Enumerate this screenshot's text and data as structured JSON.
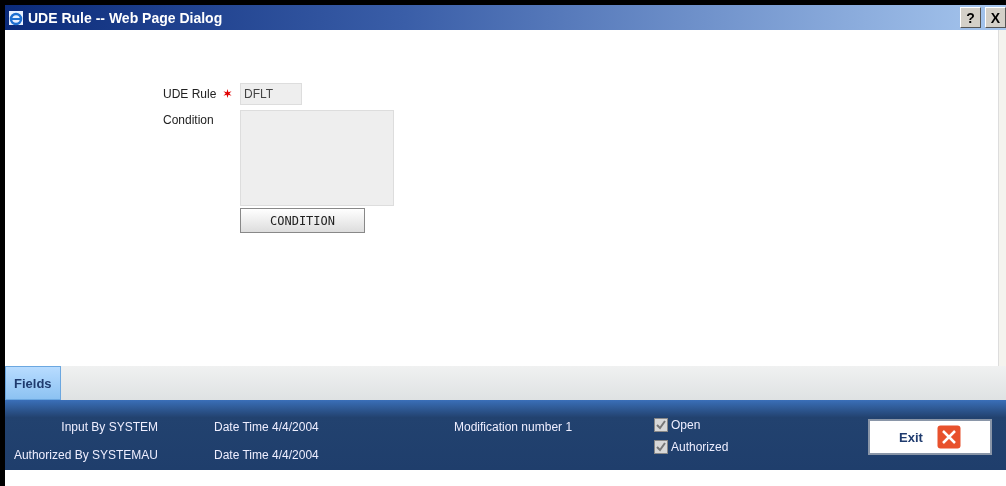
{
  "window": {
    "title": "UDE Rule -- Web Page Dialog",
    "help_button": "?",
    "close_button": "X"
  },
  "form": {
    "ude_rule_label": "UDE Rule",
    "ude_rule_required": true,
    "ude_rule_value": "DFLT",
    "condition_label": "Condition",
    "condition_button": "CONDITION"
  },
  "tabs": [
    {
      "label": "Fields",
      "selected": true
    }
  ],
  "footer": {
    "input_by": "Input By SYSTEM",
    "input_date": "Date Time 4/4/2004",
    "authorized_by": "Authorized By SYSTEMAU",
    "authorized_date": "Date Time 4/4/2004",
    "modification": "Modification number 1",
    "checks": [
      {
        "label": "Open",
        "checked": true
      },
      {
        "label": "Authorized",
        "checked": true
      }
    ],
    "exit_button": "Exit"
  }
}
